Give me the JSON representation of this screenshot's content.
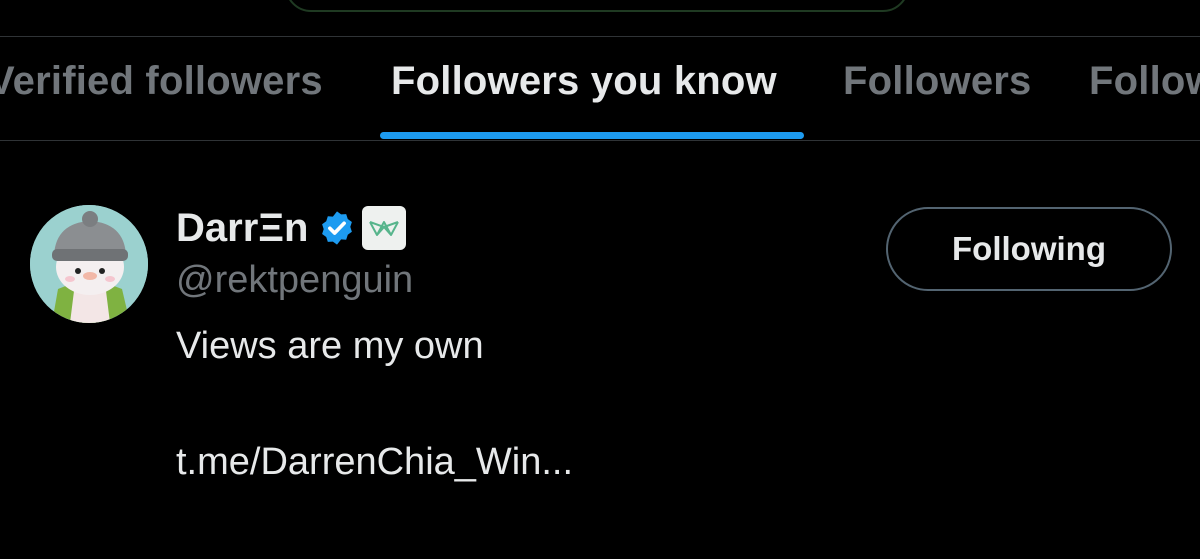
{
  "tabs": [
    {
      "label": "Verified followers"
    },
    {
      "label": "Followers you know"
    },
    {
      "label": "Followers"
    },
    {
      "label": "Following"
    }
  ],
  "active_tab": "Followers you know",
  "user": {
    "display_name": "DarrΞn",
    "handle": "@rektpenguin",
    "bio": "Views are my own",
    "link": "t.me/DarrenChia_Win...",
    "follow_button_label": "Following",
    "avatar_icon": "penguin-avatar-icon",
    "verified_icon": "verified-badge-icon",
    "affiliation_icon": "affiliation-logo-icon"
  },
  "colors": {
    "background": "#000000",
    "primary_text": "#e7e9ea",
    "secondary_text": "#71767b",
    "accent": "#1d9bf0",
    "divider": "#2f3336"
  }
}
